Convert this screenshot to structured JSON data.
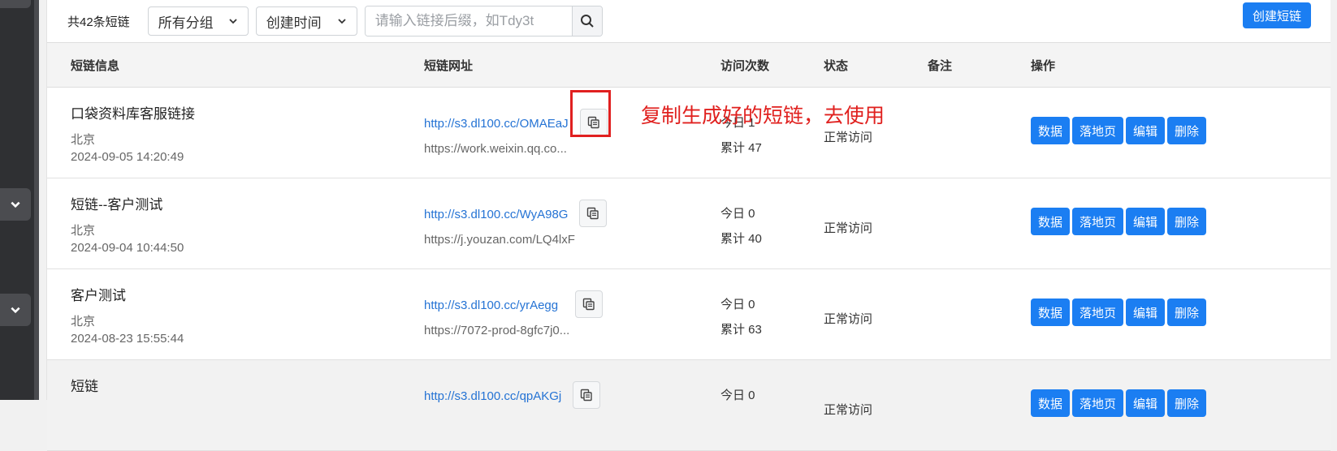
{
  "toolbar": {
    "count_label": "共42条短链",
    "group_select": "所有分组",
    "sort_select": "创建时间",
    "search_placeholder": "请输入链接后缀，如Tdy3t",
    "create_label": "创建短链"
  },
  "table": {
    "headers": {
      "info": "短链信息",
      "url": "短链网址",
      "visits": "访问次数",
      "status": "状态",
      "remark": "备注",
      "actions": "操作"
    },
    "rows": [
      {
        "name": "口袋资料库客服链接",
        "region": "北京",
        "time": "2024-09-05 14:20:49",
        "short_url": "http://s3.dl100.cc/OMAEaJ",
        "target": "https://work.weixin.qq.co...",
        "today": "今日 1",
        "total": "累计 47",
        "status": "正常访问"
      },
      {
        "name": "短链--客户测试",
        "region": "北京",
        "time": "2024-09-04 10:44:50",
        "short_url": "http://s3.dl100.cc/WyA98G",
        "target": "https://j.youzan.com/LQ4lxF",
        "today": "今日 0",
        "total": "累计 40",
        "status": "正常访问"
      },
      {
        "name": "客户测试",
        "region": "北京",
        "time": "2024-08-23 15:55:44",
        "short_url": "http://s3.dl100.cc/yrAegg",
        "target": "https://7072-prod-8gfc7j0...",
        "today": "今日 0",
        "total": "累计 63",
        "status": "正常访问"
      },
      {
        "name": "短链",
        "region": "",
        "time": "",
        "short_url": "http://s3.dl100.cc/qpAKGj",
        "target": "",
        "today": "今日 0",
        "total": "",
        "status": "正常访问"
      }
    ],
    "action_labels": {
      "data": "数据",
      "landing": "落地页",
      "edit": "编辑",
      "delete": "删除"
    }
  },
  "annotation": {
    "text": "复制生成好的短链，去使用",
    "color": "#e0201e"
  },
  "colors": {
    "accent": "#1b7ef2",
    "link": "#2573d4"
  },
  "icons": {
    "sidebar_toggle": "chevron-down-icon",
    "search": "search-icon",
    "copy": "copy-icon"
  }
}
